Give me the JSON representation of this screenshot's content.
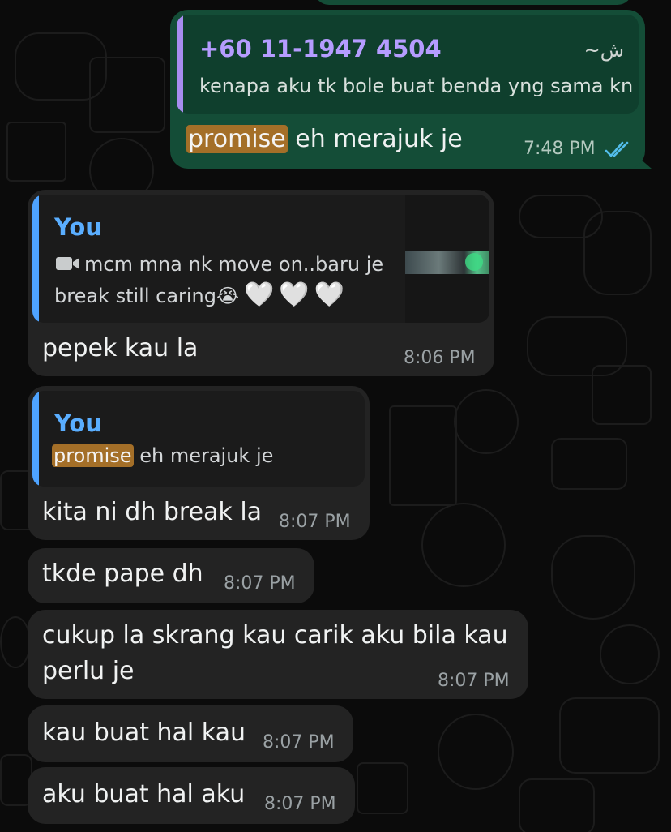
{
  "colors": {
    "incoming_bubble": "#232323",
    "outgoing_bubble": "#144d37",
    "quote_bg_incoming": "#1b1b1b",
    "quote_bg_outgoing": "#0f3f2d",
    "quote_bar_purple": "#a78df0",
    "quote_bar_blue": "#4ea3ff",
    "highlight": "#a46f28",
    "read_ticks": "#53bdeb"
  },
  "messages": [
    {
      "direction": "outgoing",
      "quote": {
        "sender": "+60 11-1947 4504",
        "sender_alt": "~ش",
        "text": "kenapa aku tk bole buat benda yng sama kn"
      },
      "text_highlight": "promise",
      "text_rest": " eh merajuk je",
      "time": "7:48 PM",
      "status_icon": "double-check-icon"
    },
    {
      "direction": "incoming",
      "quote": {
        "sender": "You",
        "media_icon": "video-camera-icon",
        "line1": "mcm mna nk move on..baru je",
        "line2": "break still caring",
        "emoji": "😭",
        "hearts": [
          "🤍",
          "🤍",
          "🤍"
        ],
        "thumbnail": "video-thumbnail"
      },
      "text": "pepek kau la",
      "time": "8:06 PM"
    },
    {
      "direction": "incoming",
      "quote": {
        "sender": "You",
        "text_highlight": "promise",
        "text_rest": " eh merajuk je"
      },
      "text": "kita ni dh break la",
      "time": "8:07 PM"
    },
    {
      "direction": "incoming",
      "text": "tkde pape dh",
      "time": "8:07 PM"
    },
    {
      "direction": "incoming",
      "line1": "cukup la skrang kau carik aku bila kau",
      "line2": "perlu je",
      "time": "8:07 PM"
    },
    {
      "direction": "incoming",
      "text": "kau buat hal kau",
      "time": "8:07 PM"
    },
    {
      "direction": "incoming",
      "text": "aku buat hal aku",
      "time": "8:07 PM"
    }
  ]
}
